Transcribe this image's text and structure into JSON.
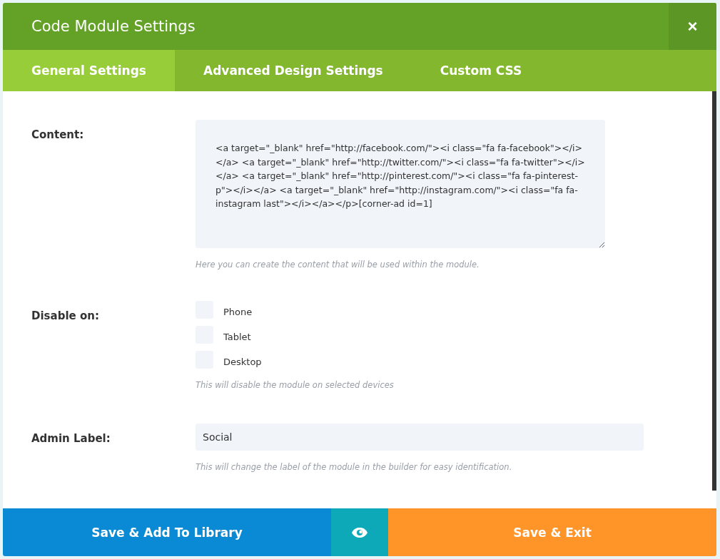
{
  "window": {
    "title": "Code Module Settings",
    "close": "×"
  },
  "tabs": [
    {
      "label": "General Settings",
      "selected": true
    },
    {
      "label": "Advanced Design Settings",
      "selected": false
    },
    {
      "label": "Custom CSS",
      "selected": false
    }
  ],
  "content": {
    "label": "Content:",
    "value": "<a target=\"_blank\" href=\"http://facebook.com/\"><i class=\"fa fa-facebook\"></i></a> <a target=\"_blank\" href=\"http://twitter.com/\"><i class=\"fa fa-twitter\"></i></a> <a target=\"_blank\" href=\"http://pinterest.com/\"><i class=\"fa fa-pinterest-p\"></i></a> <a target=\"_blank\" href=\"http://instagram.com/\"><i class=\"fa fa-instagram last\"></i></a></p>[corner-ad id=1]",
    "hint": "Here you can create the content that will be used within the module."
  },
  "disable_on": {
    "label": "Disable on:",
    "options": [
      {
        "label": "Phone",
        "checked": false
      },
      {
        "label": "Tablet",
        "checked": false
      },
      {
        "label": "Desktop",
        "checked": false
      }
    ],
    "hint": "This will disable the module on selected devices"
  },
  "admin_label": {
    "label": "Admin Label:",
    "value": "Social",
    "hint": "This will change the label of the module in the builder for easy identification."
  },
  "footer": {
    "library_button": "Save & Add To Library",
    "exit_button": "Save & Exit"
  }
}
